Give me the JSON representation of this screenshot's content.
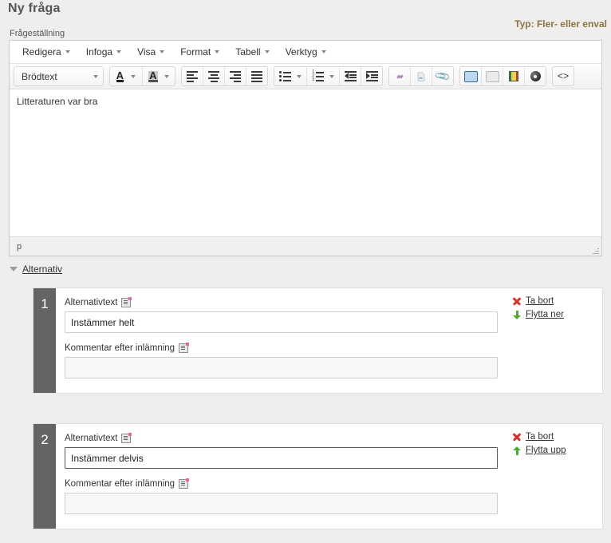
{
  "header": {
    "title": "Ny fråga",
    "type_label": "Typ: Fler- eller enval",
    "question_field_label": "Frågeställning"
  },
  "editor": {
    "menus": [
      {
        "label": "Redigera"
      },
      {
        "label": "Infoga"
      },
      {
        "label": "Visa"
      },
      {
        "label": "Format"
      },
      {
        "label": "Tabell"
      },
      {
        "label": "Verktyg"
      }
    ],
    "format_select": {
      "value": "Brödtext"
    },
    "toolbar_icons": [
      "text-color-icon",
      "background-color-icon",
      "align-left-icon",
      "align-center-icon",
      "align-right-icon",
      "align-justify-icon",
      "bullet-list-icon",
      "numbered-list-icon",
      "outdent-icon",
      "indent-icon",
      "link-icon",
      "unlink-icon",
      "attachment-icon",
      "insert-media-icon",
      "insert-template-icon",
      "insert-video-icon",
      "insert-audio-icon",
      "source-code-icon"
    ],
    "content": "Litteraturen var bra",
    "statusbar_path": "p"
  },
  "alternatives_section": {
    "toggle_label": "Alternativ",
    "items": [
      {
        "number": "1",
        "text_label": "Alternativtext",
        "text_value": "Instämmer helt",
        "comment_label": "Kommentar efter inlämning",
        "comment_value": "",
        "delete_label": "Ta bort",
        "move_label": "Flytta ner",
        "move_direction": "down"
      },
      {
        "number": "2",
        "text_label": "Alternativtext",
        "text_value": "Instämmer delvis",
        "comment_label": "Kommentar efter inlämning",
        "comment_value": "",
        "delete_label": "Ta bort",
        "move_label": "Flytta upp",
        "move_direction": "up"
      }
    ]
  },
  "colors": {
    "type_label": "#8a7640",
    "number_bar": "#646464",
    "delete_icon": "#d0332c",
    "move_icon": "#4ea832",
    "page_background": "#efeeed"
  }
}
